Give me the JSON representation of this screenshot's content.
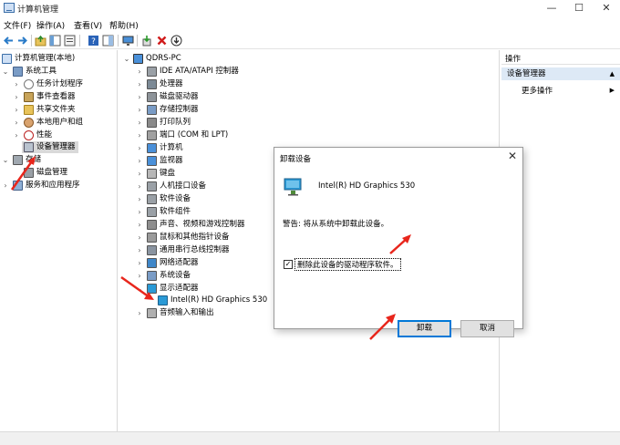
{
  "window": {
    "title": "计算机管理",
    "minimize": "—",
    "maximize": "☐",
    "close": "✕"
  },
  "menu": [
    "文件(F)",
    "操作(A)",
    "查看(V)",
    "帮助(H)"
  ],
  "left_tree": {
    "root": "计算机管理(本地)",
    "system_tools": "系统工具",
    "task_scheduler": "任务计划程序",
    "event_viewer": "事件查看器",
    "shared_folders": "共享文件夹",
    "local_users": "本地用户和组",
    "performance": "性能",
    "device_manager": "设备管理器",
    "storage": "存储",
    "disk_management": "磁盘管理",
    "services_apps": "服务和应用程序"
  },
  "device_tree": {
    "root": "QDRS-PC",
    "items": [
      "IDE ATA/ATAPI 控制器",
      "处理器",
      "磁盘驱动器",
      "存储控制器",
      "打印队列",
      "端口 (COM 和 LPT)",
      "计算机",
      "监视器",
      "键盘",
      "人机接口设备",
      "软件设备",
      "软件组件",
      "声音、视频和游戏控制器",
      "鼠标和其他指针设备",
      "通用串行总线控制器",
      "网络适配器",
      "系统设备",
      "显示适配器"
    ],
    "child": "Intel(R) HD Graphics 530",
    "last": "音频输入和输出"
  },
  "actions": {
    "header": "操作",
    "section": "设备管理器",
    "more": "更多操作"
  },
  "dialog": {
    "title": "卸载设备",
    "close": "✕",
    "device": "Intel(R) HD Graphics 530",
    "warning": "警告: 将从系统中卸载此设备。",
    "checkbox": "删除此设备的驱动程序软件。",
    "checkbox_mark": "✓",
    "uninstall": "卸载",
    "cancel": "取消"
  },
  "colors": {
    "accent": "#0078d7",
    "annotation": "#e8261c"
  }
}
